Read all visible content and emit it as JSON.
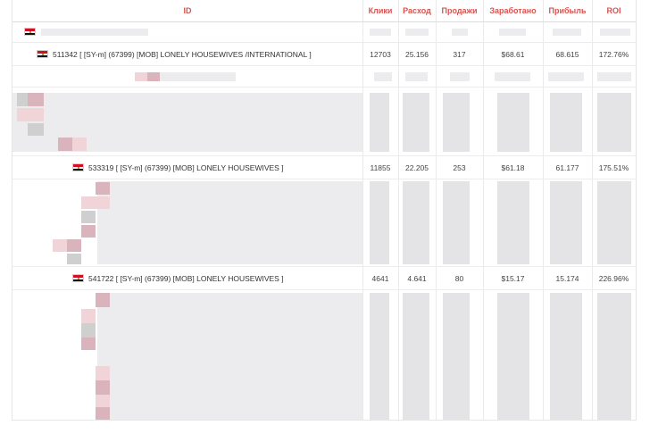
{
  "columns": {
    "id": "ID",
    "clicks": "Клики",
    "spend": "Расход",
    "sales": "Продажи",
    "earned": "Заработано",
    "profit": "Прибыль",
    "roi": "ROI"
  },
  "rows": [
    {
      "id": "511342 [ [SY-m] (67399) [MOB] LONELY HOUSEWIVES /INTERNATIONAL ]",
      "clicks": "12703",
      "spend": "25.156",
      "sales": "317",
      "earned": "$68.61",
      "profit": "68.615",
      "roi": "172.76%"
    },
    {
      "id": "533319 [ [SY-m] (67399) [MOB] LONELY HOUSEWIVES ]",
      "clicks": "11855",
      "spend": "22.205",
      "sales": "253",
      "earned": "$61.18",
      "profit": "61.177",
      "roi": "175.51%"
    },
    {
      "id": "541722 [ [SY-m] (67399) [MOB] LONELY HOUSEWIVES ]",
      "clicks": "4641",
      "spend": "4.641",
      "sales": "80",
      "earned": "$15.17",
      "profit": "15.174",
      "roi": "226.96%"
    }
  ],
  "flag_icon": "egypt-flag-icon"
}
